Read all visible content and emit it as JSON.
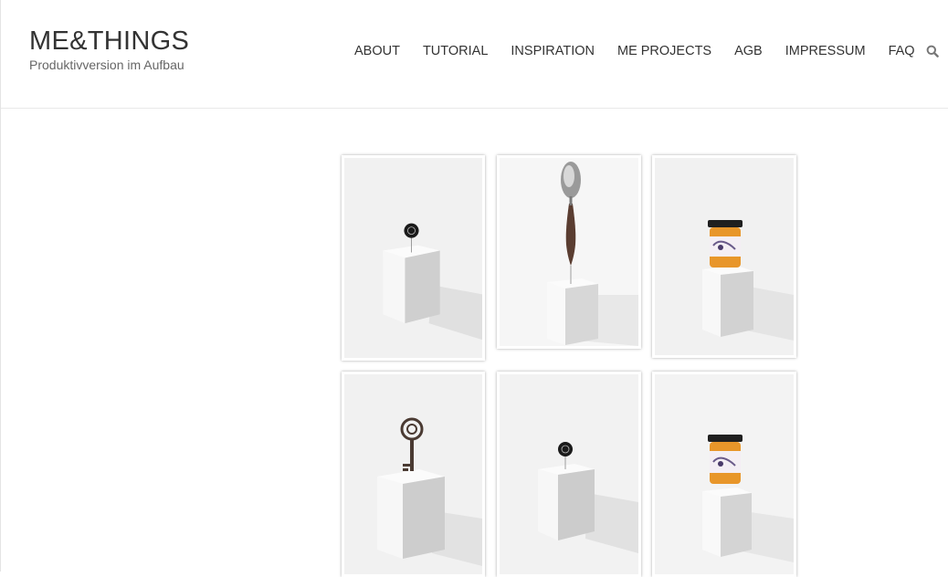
{
  "site": {
    "title": "ME&THINGS",
    "tagline": "Produktivversion im Aufbau"
  },
  "nav": {
    "items": [
      "ABOUT",
      "TUTORIAL",
      "INSPIRATION",
      "ME PROJECTS",
      "AGB",
      "IMPRESSUM",
      "FAQ"
    ],
    "search_icon": "search-icon"
  },
  "gallery": {
    "items": [
      {
        "object": "black-button-on-pin",
        "alt": ""
      },
      {
        "object": "spoon-on-pin",
        "alt": ""
      },
      {
        "object": "honey-jar",
        "alt": ""
      },
      {
        "object": "antique-key-on-pin",
        "alt": ""
      },
      {
        "object": "black-button-on-pin",
        "alt": ""
      },
      {
        "object": "honey-jar",
        "alt": ""
      }
    ]
  },
  "colors": {
    "text": "#333333",
    "tagline": "#666666",
    "border": "#e8e8e8",
    "photo_background": "#f2f2f2",
    "honey": "#e8962a"
  }
}
